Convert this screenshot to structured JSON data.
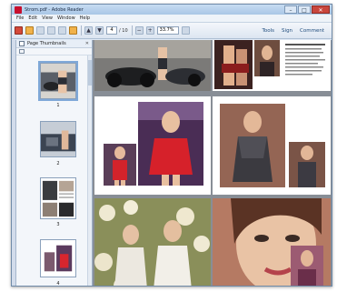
{
  "window": {
    "title": "Strom.pdf - Adobe Reader",
    "min_glyph": "–",
    "max_glyph": "□",
    "close_glyph": "✕"
  },
  "menu": [
    "File",
    "Edit",
    "View",
    "Window",
    "Help"
  ],
  "toolbar": {
    "page_current": "4",
    "page_total": "/ 10",
    "zoom": "33.7%",
    "tools_label": "Tools",
    "sign_label": "Sign",
    "comment_label": "Comment"
  },
  "panel": {
    "title": "Page Thumbnails",
    "close_glyph": "✕"
  },
  "thumbnails": [
    {
      "page": "1"
    },
    {
      "page": "2"
    },
    {
      "page": "3"
    },
    {
      "page": "4"
    }
  ],
  "colors": {
    "accent": "#c8102e",
    "panel_bg": "#f3f6fa",
    "document_bg": "#888e96",
    "selection": "#7fa8d8"
  },
  "icons": [
    "create-icon",
    "open-icon",
    "save-icon",
    "print-icon",
    "email-icon",
    "share-icon",
    "up-arrow-icon",
    "down-arrow-icon",
    "zoom-out-icon",
    "zoom-in-icon",
    "select-icon"
  ]
}
